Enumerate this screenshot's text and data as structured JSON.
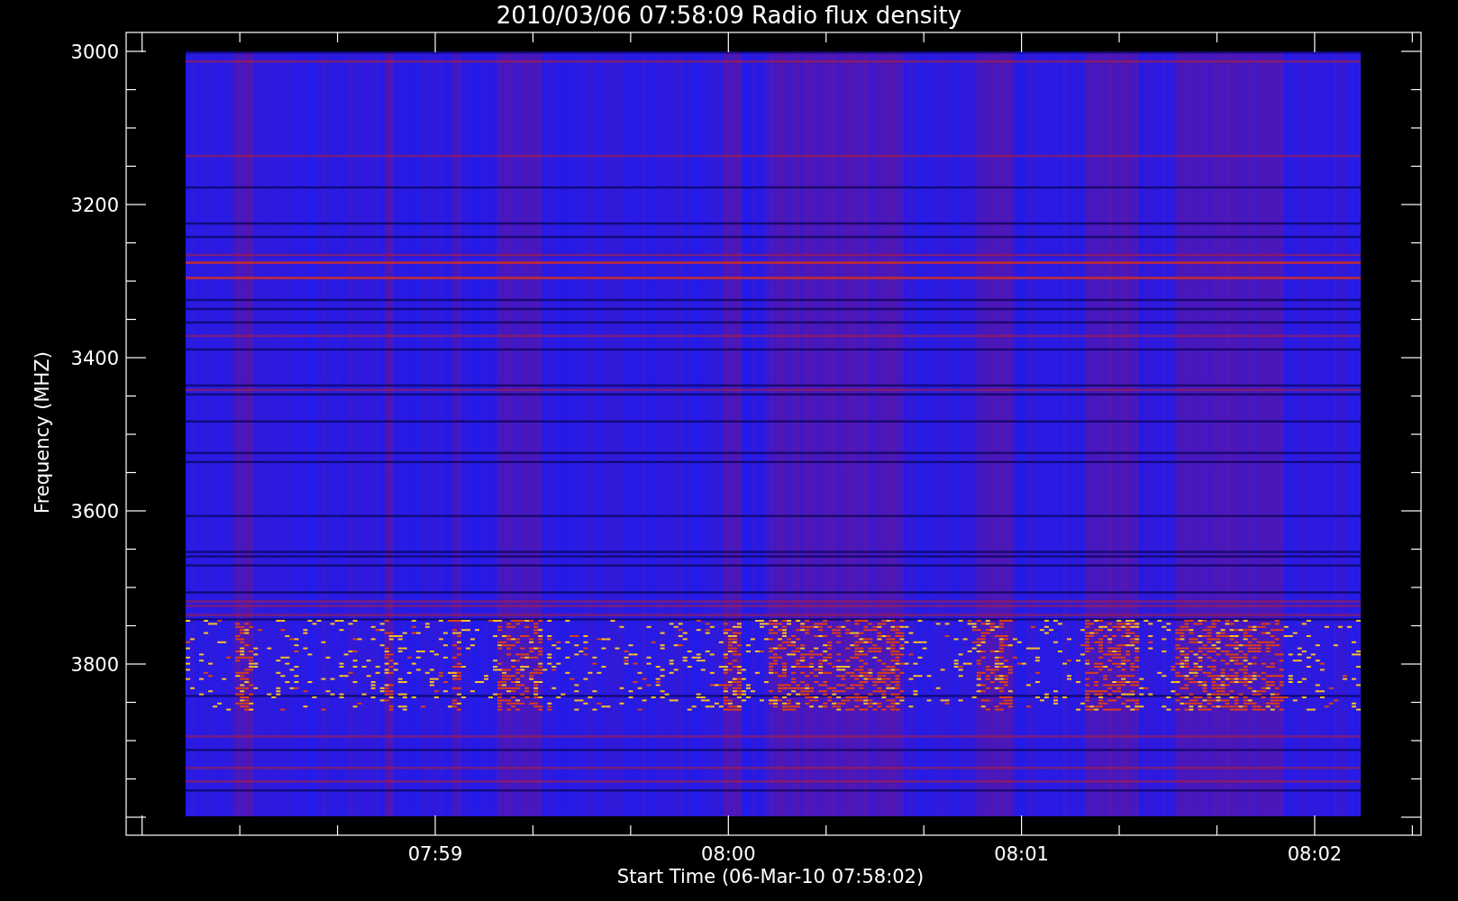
{
  "plot": {
    "title": "2010/03/06 07:58:09 Radio flux density",
    "xlabel": "Start Time (06-Mar-10 07:58:02)",
    "ylabel": "Frequency (MHZ)",
    "yticks": [
      "3000",
      "3200",
      "3400",
      "3600",
      "3800"
    ],
    "xticks": [
      "07:59",
      "08:00",
      "08:01",
      "08:02"
    ]
  }
}
